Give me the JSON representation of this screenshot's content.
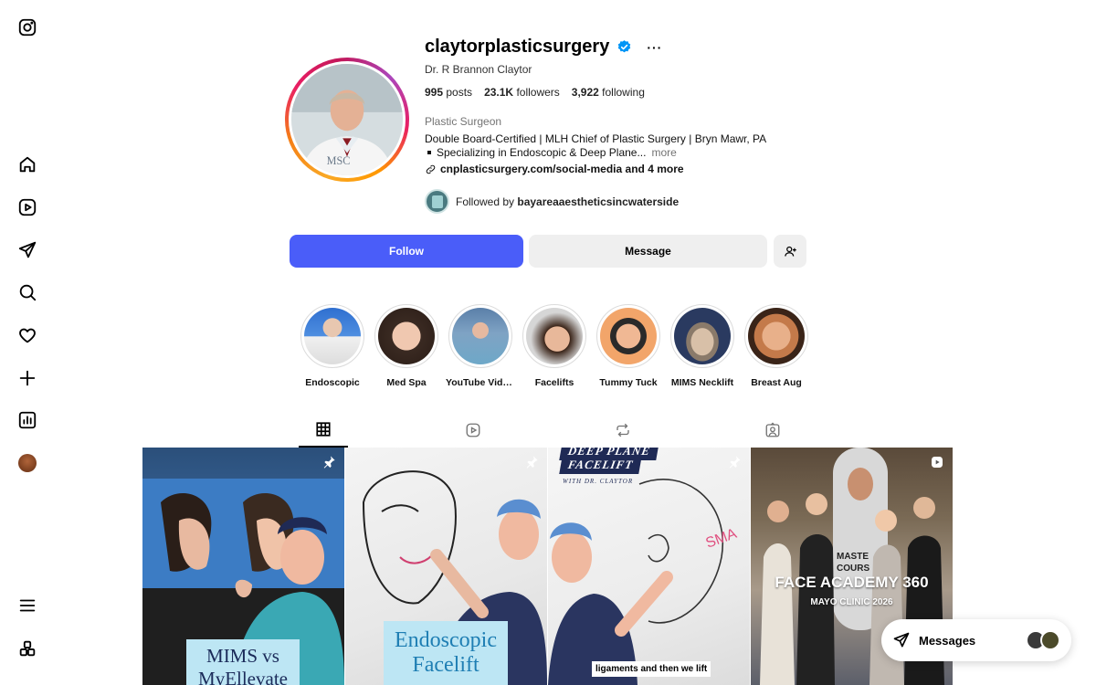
{
  "nav": {
    "items": [
      {
        "icon": "instagram-icon"
      },
      {
        "icon": "home-icon"
      },
      {
        "icon": "reels-icon"
      },
      {
        "icon": "direct-icon"
      },
      {
        "icon": "search-icon"
      },
      {
        "icon": "notifications-heart-icon"
      },
      {
        "icon": "create-plus-icon"
      },
      {
        "icon": "dashboard-icon"
      },
      {
        "icon": "profile-avatar"
      },
      {
        "icon": "menu-icon"
      },
      {
        "icon": "also-from-meta-icon"
      }
    ]
  },
  "profile": {
    "username": "claytorplasticsurgery",
    "verified": true,
    "more_label": "···",
    "full_name": "Dr. R Brannon Claytor",
    "stats": {
      "posts_count": "995",
      "posts_label": "posts",
      "followers_count": "23.1K",
      "followers_label": "followers",
      "following_count": "3,922",
      "following_label": "following"
    },
    "category": "Plastic Surgeon",
    "bio_line1": "Double Board-Certified | MLH Chief of Plastic Surgery | Bryn Mawr, PA",
    "bio_line2": "Specializing in Endoscopic & Deep Plane...",
    "bio_more": "more",
    "link_text": "cnplasticsurgery.com/social-media and 4 more",
    "followed_by_prefix": "Followed by",
    "followed_by_user": "bayareaaestheticsincwaterside"
  },
  "actions": {
    "follow_label": "Follow",
    "message_label": "Message",
    "follow_color": "#4a5df9"
  },
  "highlights": [
    {
      "label": "Endoscopic"
    },
    {
      "label": "Med Spa"
    },
    {
      "label": "YouTube Vide..."
    },
    {
      "label": "Facelifts"
    },
    {
      "label": "Tummy Tuck"
    },
    {
      "label": "MIMS Necklift"
    },
    {
      "label": "Breast Aug"
    }
  ],
  "tabs": [
    {
      "icon": "grid-icon",
      "active": true
    },
    {
      "icon": "reels-icon",
      "active": false
    },
    {
      "icon": "reposts-icon",
      "active": false
    },
    {
      "icon": "tagged-icon",
      "active": false
    }
  ],
  "posts": [
    {
      "caption": "MIMS vs MyEllevate",
      "badge": "pin-icon"
    },
    {
      "caption": "Endoscopic Facelift",
      "badge": "pin-icon"
    },
    {
      "caption_top_1": "DEEP PLANE",
      "caption_top_2": "FACELIFT",
      "caption_top_3": "WITH DR. CLAYTOR",
      "caption_bottom": "ligaments and then we lift",
      "badge": "pin-icon"
    },
    {
      "caption_title": "FACE ACADEMY 360",
      "caption_sub": "MAYO CLINIC 2026",
      "caption_side": "MASTE\nCOURS",
      "badge": "reel-icon"
    }
  ],
  "messages": {
    "label": "Messages"
  }
}
